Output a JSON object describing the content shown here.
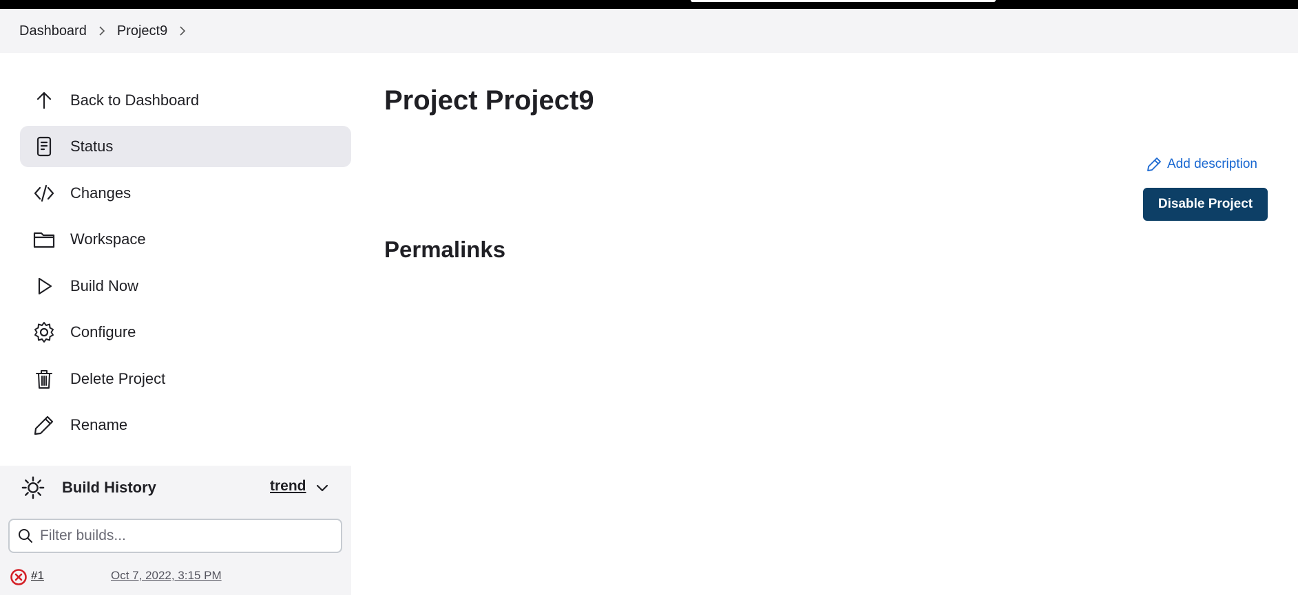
{
  "breadcrumb": {
    "items": [
      "Dashboard",
      "Project9"
    ]
  },
  "sidebar": {
    "items": [
      {
        "label": "Back to Dashboard",
        "icon": "arrow-up-icon"
      },
      {
        "label": "Status",
        "icon": "document-icon",
        "active": true
      },
      {
        "label": "Changes",
        "icon": "code-icon"
      },
      {
        "label": "Workspace",
        "icon": "folder-icon"
      },
      {
        "label": "Build Now",
        "icon": "play-icon"
      },
      {
        "label": "Configure",
        "icon": "gear-icon"
      },
      {
        "label": "Delete Project",
        "icon": "trash-icon"
      },
      {
        "label": "Rename",
        "icon": "pencil-icon"
      }
    ]
  },
  "build_history": {
    "title": "Build History",
    "trend_label": "trend",
    "filter_placeholder": "Filter builds...",
    "builds": [
      {
        "number": "#1",
        "date": "Oct 7, 2022, 3:15 PM",
        "status": "failed"
      }
    ]
  },
  "main": {
    "title": "Project Project9",
    "add_description": "Add description",
    "disable_button": "Disable Project",
    "permalinks_title": "Permalinks"
  },
  "colors": {
    "accent_link": "#1867d1",
    "primary_button": "#0d3f66",
    "failure": "#d42027"
  }
}
